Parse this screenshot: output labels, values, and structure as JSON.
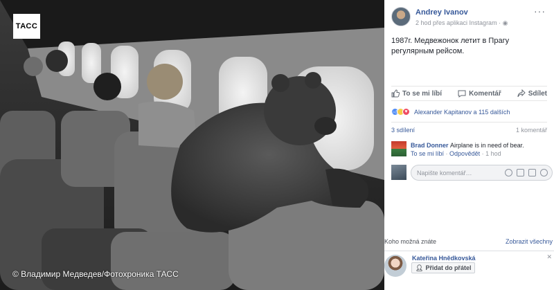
{
  "photo": {
    "logo_text": "ТАСС",
    "credit": "© Владимир Медведев/Фотохроника ТАСС"
  },
  "post": {
    "author": "Andrey Ivanov",
    "meta": "2 hod přes aplikaci Instagram",
    "meta_separator": "·",
    "text": "1987г. Медвежонок летит в Прагу регулярным рейсом.",
    "more_icon": "more-options-icon"
  },
  "actions": {
    "like": "To se mi líbí",
    "comment": "Komentář",
    "share": "Sdílet"
  },
  "reactions": {
    "text": "Alexander Kapitanov a 115 dalších",
    "icons": [
      "like-icon",
      "wow-icon",
      "love-icon"
    ],
    "colors": {
      "like": "#4f8bf5",
      "wow": "#f7cc4a",
      "love": "#ef4c63"
    }
  },
  "stats": {
    "shares": "3 sdílení",
    "comments": "1 komentář"
  },
  "comment": {
    "author": "Brad Donner",
    "text": "Airplane is in need of bear.",
    "like_link": "To se mi líbí",
    "reply_link": "Odpovědět",
    "time": "1 hod",
    "separator": "·"
  },
  "reply": {
    "placeholder": "Napište komentář…"
  },
  "suggestions": {
    "title": "Koho možná znáte",
    "see_all": "Zobrazit všechny",
    "person_name": "Kateřina Hnědkovská",
    "add_friend": "Přidat do přátel"
  },
  "colors": {
    "link": "#365899",
    "muted": "#90949c"
  }
}
